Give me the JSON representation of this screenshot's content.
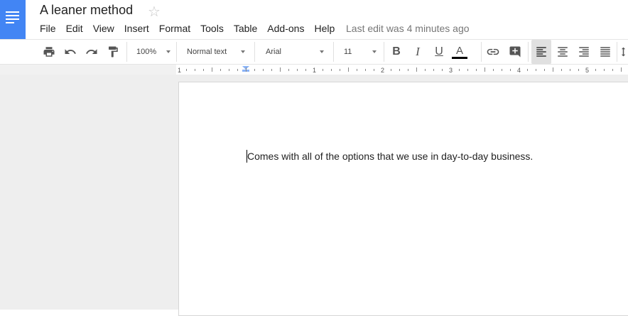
{
  "header": {
    "title": "A leaner method",
    "star_glyph": "☆",
    "last_edit": "Last edit was 4 minutes ago"
  },
  "menu": [
    "File",
    "Edit",
    "View",
    "Insert",
    "Format",
    "Tools",
    "Table",
    "Add-ons",
    "Help"
  ],
  "toolbar": {
    "zoom": "100%",
    "style": "Normal text",
    "font": "Arial",
    "size": "11",
    "bold_glyph": "B",
    "italic_glyph": "I",
    "underline_glyph": "U",
    "text_color_glyph": "A",
    "text_color": "#000000",
    "active_align": "left"
  },
  "ruler": {
    "labels": [
      "1",
      "1",
      "2",
      "3",
      "4",
      "5"
    ]
  },
  "document": {
    "text": "Comes with all of the options that we use in day-to-day business."
  },
  "colors": {
    "app_accent": "#4285f4",
    "canvas_bg": "#eeeeee"
  }
}
